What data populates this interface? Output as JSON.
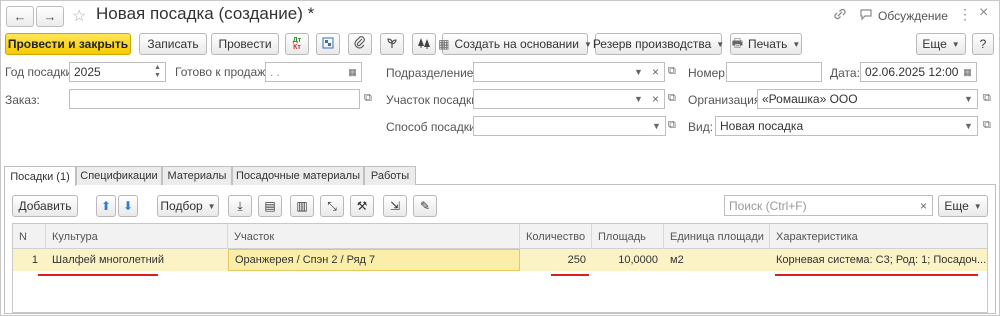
{
  "window": {
    "title": "Новая посадка (создание) *",
    "nav_back": "←",
    "nav_forward": "→",
    "favorite": "☆",
    "link_icon": "⚲",
    "discuss_label": "Обсуждение",
    "menu_icon": "⋮",
    "close_icon": "×"
  },
  "toolbar": {
    "post_close": "Провести и закрыть",
    "save": "Записать",
    "post": "Провести",
    "create_based": "Создать на основании",
    "reserve": "Резерв производства",
    "print": "Печать",
    "more": "Еще",
    "help": "?"
  },
  "form": {
    "year_label": "Год посадки:",
    "year_value": "2025",
    "ready_label": "Готово к продаже:",
    "ready_value": " .  .",
    "order_label": "Заказ:",
    "order_value": "",
    "division_label": "Подразделение:",
    "division_value": "",
    "plot_label": "Участок посадки:",
    "plot_value": "",
    "method_label": "Способ посадки:",
    "method_value": "",
    "number_label": "Номер:",
    "number_value": "",
    "date_label": "Дата:",
    "date_value": "02.06.2025 12:00:00",
    "org_label": "Организация:",
    "org_value": "«Ромашка» ООО",
    "kind_label": "Вид:",
    "kind_value": "Новая посадка"
  },
  "tabs": [
    {
      "label": "Посадки (1)"
    },
    {
      "label": "Спецификации"
    },
    {
      "label": "Материалы"
    },
    {
      "label": "Посадочные материалы"
    },
    {
      "label": "Работы"
    }
  ],
  "table_toolbar": {
    "add": "Добавить",
    "pick": "Подбор",
    "search_placeholder": "Поиск (Ctrl+F)",
    "more": "Еще"
  },
  "table": {
    "columns": [
      "N",
      "Культура",
      "Участок",
      "Количество",
      "Площадь",
      "Единица площади",
      "Характеристика"
    ],
    "rows": [
      {
        "n": "1",
        "culture": "Шалфей многолетний",
        "plot": "Оранжерея / Спэн 2 / Ряд 7",
        "quantity": "250",
        "area": "10,0000",
        "area_unit": "м2",
        "characteristic": "Корневая система: С3; Род: 1; Посадоч..."
      }
    ]
  },
  "colors": {
    "primary_button": "#f7c900",
    "selected_row": "#fbf3c5",
    "highlight_underline": "#e21b1b",
    "arrow_blue": "#2f7fd6"
  }
}
